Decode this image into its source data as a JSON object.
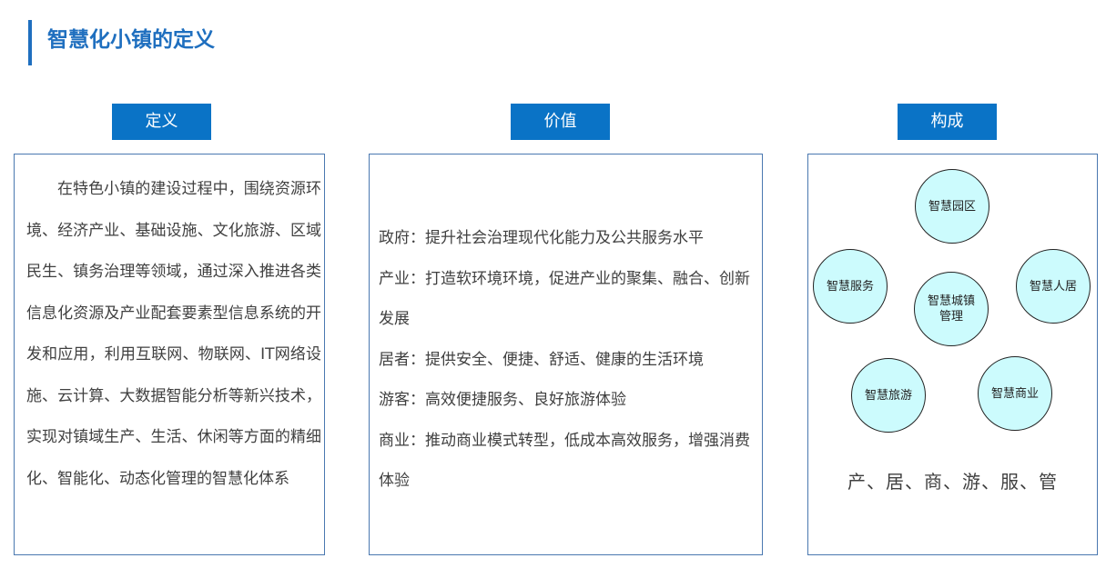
{
  "page": {
    "title": "智慧化小镇的定义"
  },
  "columns": {
    "definition": {
      "header": "定义",
      "text": "在特色小镇的建设过程中，围绕资源环境、经济产业、基础设施、文化旅游、区域民生、镇务治理等领域，通过深入推进各类信息化资源及产业配套要素型信息系统的开发和应用，利用互联网、物联网、IT网络设施、云计算、大数据智能分析等新兴技术，实现对镇域生产、生活、休闲等方面的精细化、智能化、动态化管理的智慧化体系"
    },
    "value": {
      "header": "价值",
      "items": [
        "政府：提升社会治理现代化能力及公共服务水平",
        "产业：打造软环境环境，促进产业的聚集、融合、创新发展",
        "居者：提供安全、便捷、舒适、健康的生活环境",
        "游客：高效便捷服务、良好旅游体验",
        "商业：推动商业模式转型，低成本高效服务，增强消费体验"
      ]
    },
    "composition": {
      "header": "构成",
      "circles": {
        "park": "智慧园区",
        "service": "智慧服务",
        "center": "智慧城镇管理",
        "living": "智慧人居",
        "tourism": "智慧旅游",
        "commerce": "智慧商业"
      },
      "summary": "产、居、商、游、服、管"
    }
  },
  "colors": {
    "accent": "#1f6fbf",
    "header_bg": "#0a73c6",
    "panel_border": "#4a78b0",
    "circle_fill": "#ccfbfd"
  }
}
